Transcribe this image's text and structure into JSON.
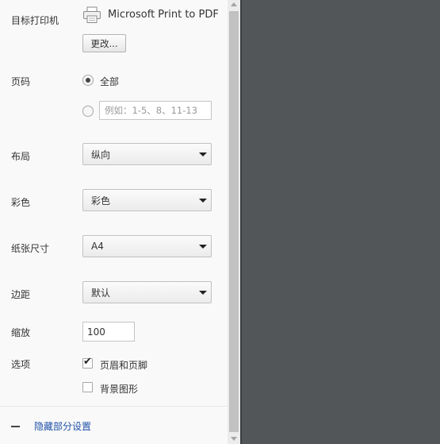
{
  "destination": {
    "label": "目标打印机",
    "printer_name": "Microsoft Print to PDF",
    "change_button": "更改...",
    "printer_icon": "printer-icon"
  },
  "pages": {
    "label": "页码",
    "option_all": "全部",
    "custom_placeholder": "例如：1-5、8、11-13"
  },
  "layout": {
    "label": "布局",
    "value": "纵向"
  },
  "color": {
    "label": "彩色",
    "value": "彩色"
  },
  "paper_size": {
    "label": "纸张尺寸",
    "value": "A4"
  },
  "margins": {
    "label": "边距",
    "value": "默认"
  },
  "scale": {
    "label": "缩放",
    "value": "100"
  },
  "options": {
    "label": "选项",
    "headers_footers": {
      "label": "页眉和页脚",
      "checked": true
    },
    "background_graphics": {
      "label": "背景图形",
      "checked": false
    }
  },
  "footer": {
    "collapse_link": "隐藏部分设置"
  },
  "colors": {
    "link": "#1f52a8",
    "preview_bg": "#525659"
  }
}
